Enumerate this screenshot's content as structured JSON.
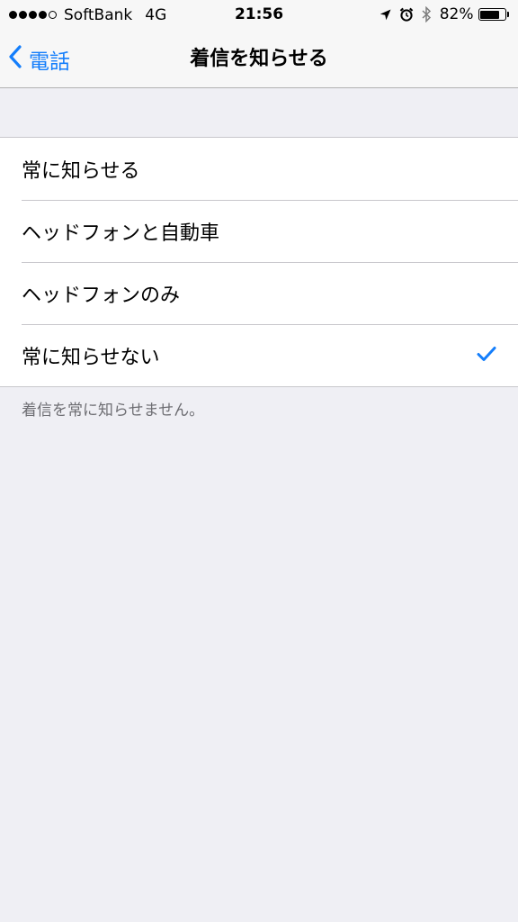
{
  "status_bar": {
    "carrier": "SoftBank",
    "network": "4G",
    "time": "21:56",
    "battery_percent": "82%",
    "battery_level": 0.82,
    "signal_bars_filled": 4,
    "signal_bars_total": 5,
    "icons": [
      "location-arrow-icon",
      "alarm-clock-icon",
      "bluetooth-icon",
      "battery-icon"
    ]
  },
  "nav": {
    "back_label": "電話",
    "title": "着信を知らせる"
  },
  "options": [
    {
      "label": "常に知らせる",
      "selected": false
    },
    {
      "label": "ヘッドフォンと自動車",
      "selected": false
    },
    {
      "label": "ヘッドフォンのみ",
      "selected": false
    },
    {
      "label": "常に知らせない",
      "selected": true
    }
  ],
  "footer": "着信を常に知らせません。",
  "colors": {
    "accent": "#147efb",
    "background": "#efeff4",
    "separator": "#c8c7cc",
    "footer_text": "#6d6d72"
  }
}
